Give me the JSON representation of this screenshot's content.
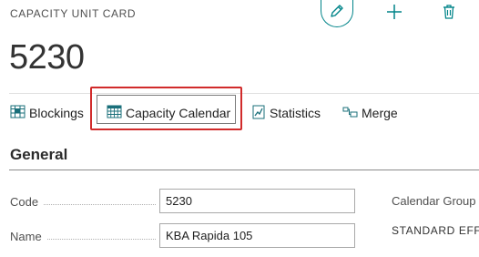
{
  "header": {
    "caption": "CAPACITY UNIT CARD",
    "record_no": "5230",
    "edit_icon": "pencil-icon",
    "new_icon": "plus-icon",
    "delete_icon": "trash-icon",
    "accent_color": "#008489"
  },
  "actions": {
    "blockings": {
      "label": "Blockings",
      "icon": "blockings-icon"
    },
    "capacity_calendar": {
      "label": "Capacity Calendar",
      "icon": "calendar-icon"
    },
    "statistics": {
      "label": "Statistics",
      "icon": "statistics-icon"
    },
    "merge": {
      "label": "Merge",
      "icon": "merge-icon"
    },
    "highlight_color": "#d12b2b"
  },
  "general": {
    "title": "General",
    "code_label": "Code",
    "code_value": "5230",
    "name_label": "Name",
    "name_value": "KBA Rapida 105",
    "calendar_group_label": "Calendar Group",
    "calendar_group_value": "STANDARD EFF"
  }
}
